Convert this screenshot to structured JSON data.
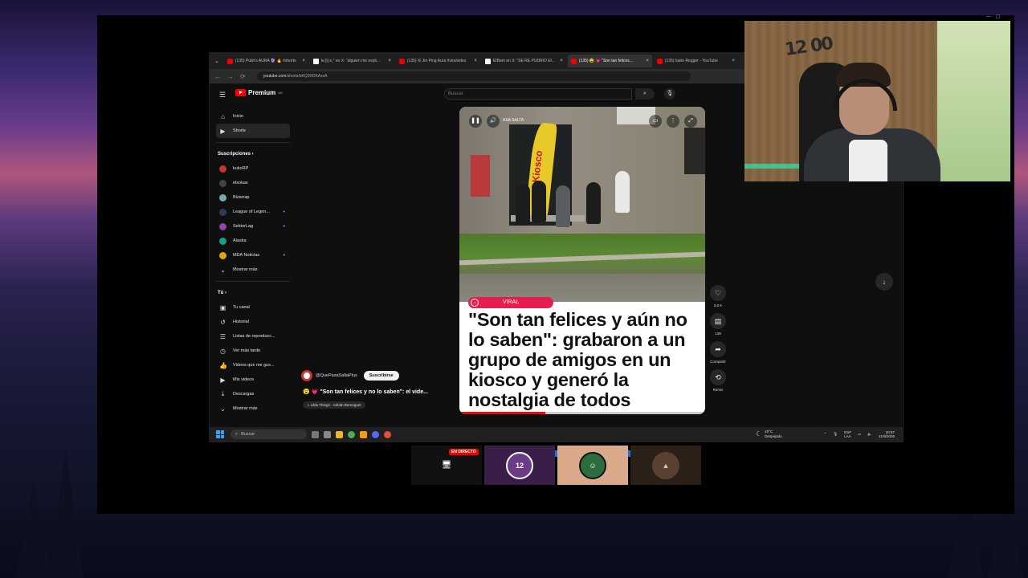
{
  "browser": {
    "tabs": [
      {
        "label": "(135) Putin's AURA 🔮 🔥 #shorts",
        "icon": "youtube-icon",
        "active": false
      },
      {
        "label": "la [i] e,\" en X: \"alguien me expli...",
        "icon": "x-icon",
        "active": false
      },
      {
        "label": "(135) Xi Jin Ping Aura #viralvideo",
        "icon": "youtube-icon",
        "active": false
      },
      {
        "label": "EIBam en X: \"SE RE PUDRIO El...",
        "icon": "x-icon",
        "active": false
      },
      {
        "label": "(135) 😮 💗 \"Son tan felices...",
        "icon": "youtube-icon",
        "active": true
      },
      {
        "label": "(135) barie Rogger - YouTube",
        "icon": "youtube-icon",
        "active": false
      }
    ],
    "url_host": "youtube.com",
    "url_path": "/shorts/bKQ3XDKAxxA"
  },
  "youtube": {
    "logo_text": "Premium",
    "logo_badge": "AR",
    "search_placeholder": "Buscar",
    "sidebar": {
      "top": [
        {
          "label": "Inicio",
          "icon": "home-icon"
        },
        {
          "label": "Shorts",
          "icon": "shorts-icon",
          "selected": true
        }
      ],
      "subs_heading": "Suscripciones ›",
      "subs": [
        {
          "label": "kukoRP",
          "color": "#c0392b"
        },
        {
          "label": "elxokas",
          "color": "#444"
        },
        {
          "label": "Bizarrap",
          "color": "#7aa"
        },
        {
          "label": "League of Legen...",
          "color": "#2c3e50",
          "dot": true
        },
        {
          "label": "SektorLag",
          "color": "#8e44ad",
          "dot": true
        },
        {
          "label": "Alaska",
          "color": "#16a085"
        },
        {
          "label": "MDA Noticias",
          "color": "#d4ac0d",
          "dot": true
        }
      ],
      "subs_more": "Mostrar más",
      "you_heading": "Tú ›",
      "you": [
        {
          "label": "Tu canal",
          "icon": "channel-icon"
        },
        {
          "label": "Historial",
          "icon": "history-icon"
        },
        {
          "label": "Listas de reproducc...",
          "icon": "playlist-icon"
        },
        {
          "label": "Ver más tarde",
          "icon": "clock-icon"
        },
        {
          "label": "Videos que me gus...",
          "icon": "thumbs-up-icon"
        },
        {
          "label": "Mis videos",
          "icon": "video-icon"
        },
        {
          "label": "Descargas",
          "icon": "download-icon"
        }
      ],
      "you_more": "Mostrar más"
    },
    "short": {
      "overlay_channel": "ASA SALTA",
      "flag_text": "Kiosco",
      "tag": "VIRAL",
      "headline": "\"Son tan felices y aún no lo saben\": grabaron a un grupo de amigos en un kiosco y generó la nostalgia de todos",
      "progress": 0.35
    },
    "actions": [
      {
        "icon": "heart-icon",
        "label": "3,6 K"
      },
      {
        "icon": "comment-icon",
        "label": "139"
      },
      {
        "icon": "share-icon",
        "label": "Compartir"
      },
      {
        "icon": "remix-icon",
        "label": "Remix"
      }
    ],
    "channel_name": "@QuePasaSaltaPlus",
    "subscribe_label": "Suscribirse",
    "video_title": "😮 💗 \"Son tan felices y no lo saben\": el vide...",
    "music": "♫ Little Things · Adrián Berenguer"
  },
  "taskbar": {
    "search": "Buscar",
    "weather_temp": "10°C",
    "weather_desc": "Despejado",
    "lang": "ESP",
    "lang2": "LAA",
    "time": "20:57",
    "date": "21/8/2026"
  },
  "cards": {
    "live_label": "EN DIRECTO",
    "logo_label": "12 00"
  }
}
